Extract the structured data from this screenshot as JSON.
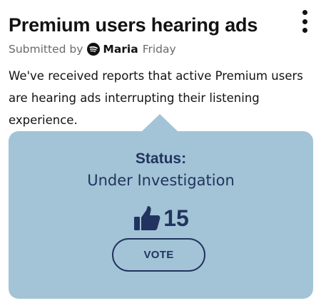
{
  "post": {
    "title": "Premium users hearing ads",
    "submitted_by_label": "Submitted by",
    "author": "Maria",
    "timestamp": "Friday",
    "body": "We've received reports that active Premium users are hearing ads interrupting their listening experience."
  },
  "status_card": {
    "label": "Status:",
    "value": "Under Investigation",
    "vote_count": "15",
    "vote_button_label": "VOTE",
    "background_color": "#a2c4d6",
    "accent_color": "#22335f"
  },
  "icons": {
    "menu": "more-vertical-icon",
    "author_logo": "spotify-logo-icon",
    "votes": "thumbs-up-icon"
  }
}
